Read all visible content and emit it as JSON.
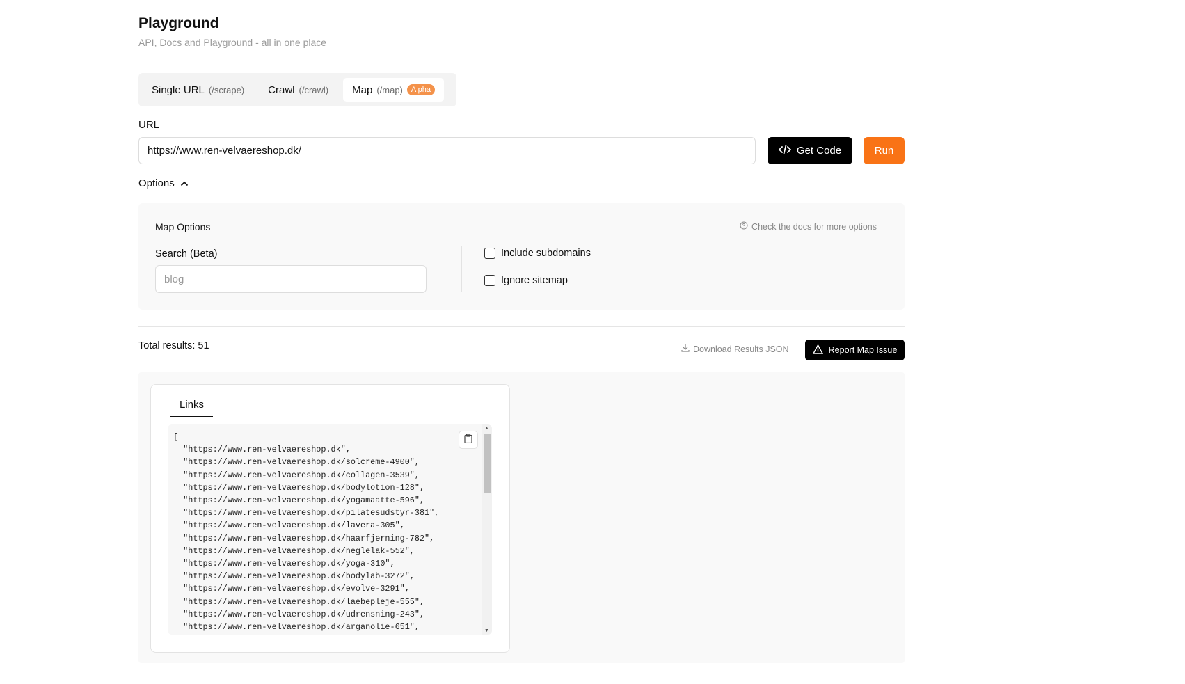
{
  "header": {
    "title": "Playground",
    "subtitle": "API, Docs and Playground - all in one place"
  },
  "tabs": [
    {
      "label": "Single URL",
      "endpoint": "(/scrape)"
    },
    {
      "label": "Crawl",
      "endpoint": "(/crawl)"
    },
    {
      "label": "Map",
      "endpoint": "(/map)",
      "badge": "Alpha"
    }
  ],
  "url": {
    "label": "URL",
    "value": "https://www.ren-velvaereshop.dk/"
  },
  "buttons": {
    "get_code": "Get Code",
    "run": "Run",
    "report": "Report Map Issue",
    "download": "Download Results JSON"
  },
  "options": {
    "toggle_label": "Options",
    "title": "Map Options",
    "docs_link": "Check the docs for more options",
    "search_label": "Search (Beta)",
    "search_placeholder": "blog",
    "include_subdomains": "Include subdomains",
    "ignore_sitemap": "Ignore sitemap"
  },
  "results": {
    "total": "Total results: 51",
    "tab": "Links",
    "links": [
      "https://www.ren-velvaereshop.dk",
      "https://www.ren-velvaereshop.dk/solcreme-4900",
      "https://www.ren-velvaereshop.dk/collagen-3539",
      "https://www.ren-velvaereshop.dk/bodylotion-128",
      "https://www.ren-velvaereshop.dk/yogamaatte-596",
      "https://www.ren-velvaereshop.dk/pilatesudstyr-381",
      "https://www.ren-velvaereshop.dk/lavera-305",
      "https://www.ren-velvaereshop.dk/haarfjerning-782",
      "https://www.ren-velvaereshop.dk/neglelak-552",
      "https://www.ren-velvaereshop.dk/yoga-310",
      "https://www.ren-velvaereshop.dk/bodylab-3272",
      "https://www.ren-velvaereshop.dk/evolve-3291",
      "https://www.ren-velvaereshop.dk/laebepleje-555",
      "https://www.ren-velvaereshop.dk/udrensning-243",
      "https://www.ren-velvaereshop.dk/arganolie-651"
    ]
  },
  "colors": {
    "accent": "#f97316",
    "badge": "#f4924a"
  }
}
